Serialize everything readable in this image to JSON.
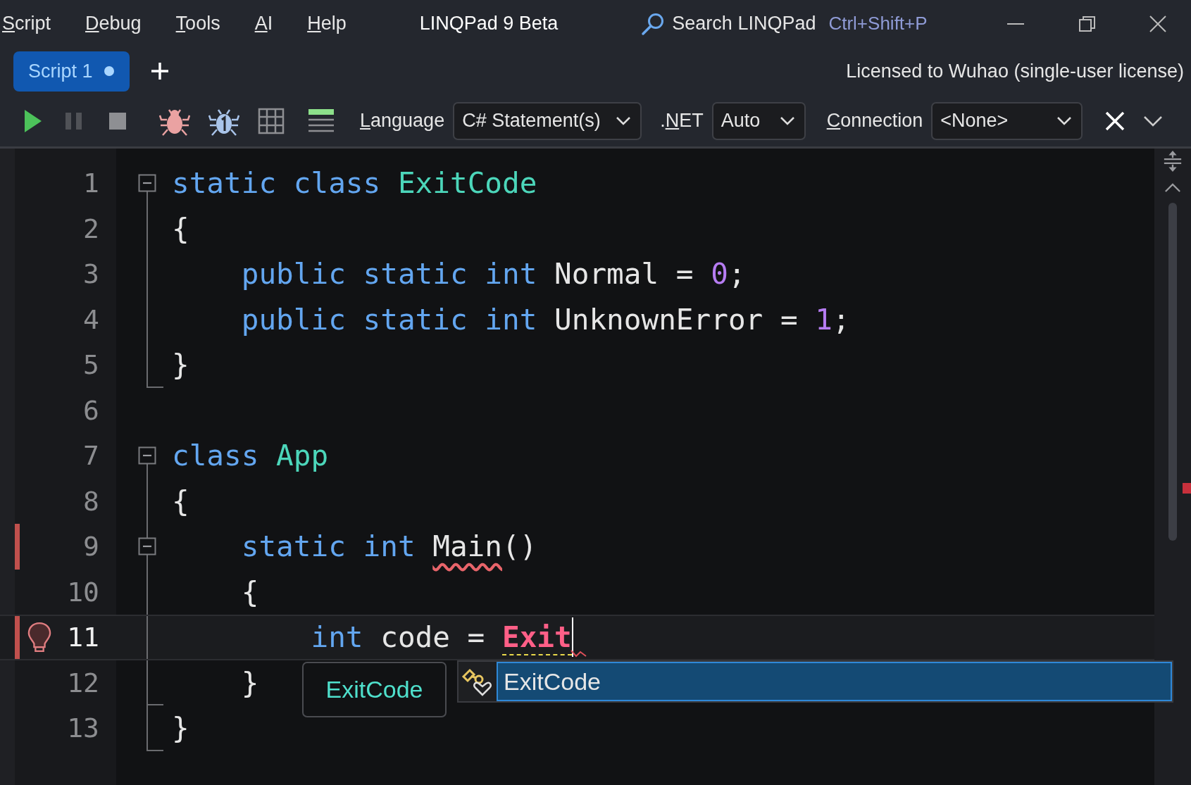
{
  "menu": [
    {
      "key": "S",
      "after": "cript"
    },
    {
      "key": "D",
      "after": "ebug"
    },
    {
      "key": "T",
      "after": "ools"
    },
    {
      "key": "A",
      "after": "I"
    },
    {
      "key": "H",
      "after": "elp"
    }
  ],
  "title": "LINQPad 9 Beta",
  "search": {
    "label": "Search LINQPad",
    "shortcut": "Ctrl+Shift+P"
  },
  "tabs": [
    {
      "label": "Script 1",
      "selected": true,
      "modified": true
    }
  ],
  "license": "Licensed to Wuhao (single-user license)",
  "toolbar": {
    "language": {
      "label": {
        "key": "L",
        "after": "anguage"
      },
      "value": "C# Statement(s)"
    },
    "framework": {
      "label": {
        "before": ".",
        "key": "N",
        "after": "ET"
      },
      "value": "Auto"
    },
    "connection": {
      "label": {
        "key": "C",
        "after": "onnection"
      },
      "value": "<None>"
    }
  },
  "editor": {
    "lines": [
      {
        "number": "1",
        "collapsible": true,
        "in_block": false,
        "block_end": false,
        "error_marker": false,
        "current": false,
        "lightbulb": false,
        "caret": false,
        "tokens": [
          {
            "kind": "keyword",
            "text": "static class"
          },
          {
            "kind": "type",
            "text": "ExitCode"
          }
        ]
      },
      {
        "number": "2",
        "collapsible": false,
        "in_block": true,
        "block_end": false,
        "error_marker": false,
        "current": false,
        "lightbulb": false,
        "caret": false,
        "tokens": [
          {
            "kind": "plain",
            "text": "{"
          }
        ]
      },
      {
        "number": "3",
        "collapsible": false,
        "in_block": true,
        "block_end": false,
        "error_marker": false,
        "current": false,
        "lightbulb": false,
        "caret": false,
        "indented": true,
        "tokens": [
          {
            "kind": "keyword",
            "text": "public static int"
          },
          {
            "kind": "plain",
            "text": "Normal ="
          },
          {
            "kind": "number",
            "text": "0"
          },
          {
            "kind": "punct",
            "text": ";"
          }
        ]
      },
      {
        "number": "4",
        "collapsible": false,
        "in_block": true,
        "block_end": false,
        "error_marker": false,
        "current": false,
        "lightbulb": false,
        "caret": false,
        "indented": true,
        "tokens": [
          {
            "kind": "keyword",
            "text": "public static int"
          },
          {
            "kind": "plain",
            "text": "UnknownError ="
          },
          {
            "kind": "number",
            "text": "1"
          },
          {
            "kind": "punct",
            "text": ";"
          }
        ]
      },
      {
        "number": "5",
        "collapsible": false,
        "in_block": false,
        "block_end": true,
        "error_marker": false,
        "current": false,
        "lightbulb": false,
        "caret": false,
        "tokens": [
          {
            "kind": "plain",
            "text": "}"
          }
        ]
      },
      {
        "number": "6",
        "collapsible": false,
        "in_block": false,
        "block_end": false,
        "error_marker": false,
        "current": false,
        "lightbulb": false,
        "caret": false
      },
      {
        "number": "7",
        "collapsible": true,
        "in_block": false,
        "block_end": false,
        "error_marker": false,
        "current": false,
        "lightbulb": false,
        "caret": false,
        "tokens": [
          {
            "kind": "keyword",
            "text": "class"
          },
          {
            "kind": "type",
            "text": "App"
          }
        ]
      },
      {
        "number": "8",
        "collapsible": false,
        "in_block": true,
        "block_end": false,
        "error_marker": false,
        "current": false,
        "lightbulb": false,
        "caret": false,
        "tokens": [
          {
            "kind": "plain",
            "text": "{"
          }
        ]
      },
      {
        "number": "9",
        "collapsible": true,
        "in_block": true,
        "block_end": false,
        "error_marker": true,
        "current": false,
        "lightbulb": false,
        "caret": false,
        "indented": true,
        "tokens": [
          {
            "kind": "keyword",
            "text": "static int"
          },
          {
            "kind": "error",
            "text": "Main"
          },
          {
            "kind": "punct",
            "text": "()"
          }
        ]
      },
      {
        "number": "10",
        "collapsible": false,
        "in_block": true,
        "block_end": false,
        "error_marker": false,
        "current": false,
        "lightbulb": false,
        "caret": false,
        "indented": true,
        "tokens": [
          {
            "kind": "plain",
            "text": "{"
          }
        ]
      },
      {
        "number": "11",
        "collapsible": false,
        "in_block": true,
        "block_end": false,
        "error_marker": true,
        "current": true,
        "lightbulb": true,
        "caret": true,
        "indented": true,
        "indented_twice": true,
        "tokens": [
          {
            "kind": "keyword",
            "text": "int"
          },
          {
            "kind": "plain",
            "text": "code ="
          },
          {
            "kind": "unresolved",
            "text": "Exit"
          }
        ]
      },
      {
        "number": "12",
        "collapsible": false,
        "in_block": true,
        "block_end": true,
        "error_marker": false,
        "current": false,
        "lightbulb": false,
        "caret": false,
        "indented": true,
        "tokens": [
          {
            "kind": "plain",
            "text": "}"
          }
        ]
      },
      {
        "number": "13",
        "collapsible": false,
        "in_block": false,
        "block_end": true,
        "error_marker": false,
        "current": false,
        "lightbulb": false,
        "caret": false,
        "tokens": [
          {
            "kind": "plain",
            "text": "}"
          }
        ]
      }
    ]
  },
  "tooltip": {
    "text": "ExitCode"
  },
  "completion": {
    "items": [
      {
        "label": "ExitCode",
        "selected": true
      }
    ]
  }
}
